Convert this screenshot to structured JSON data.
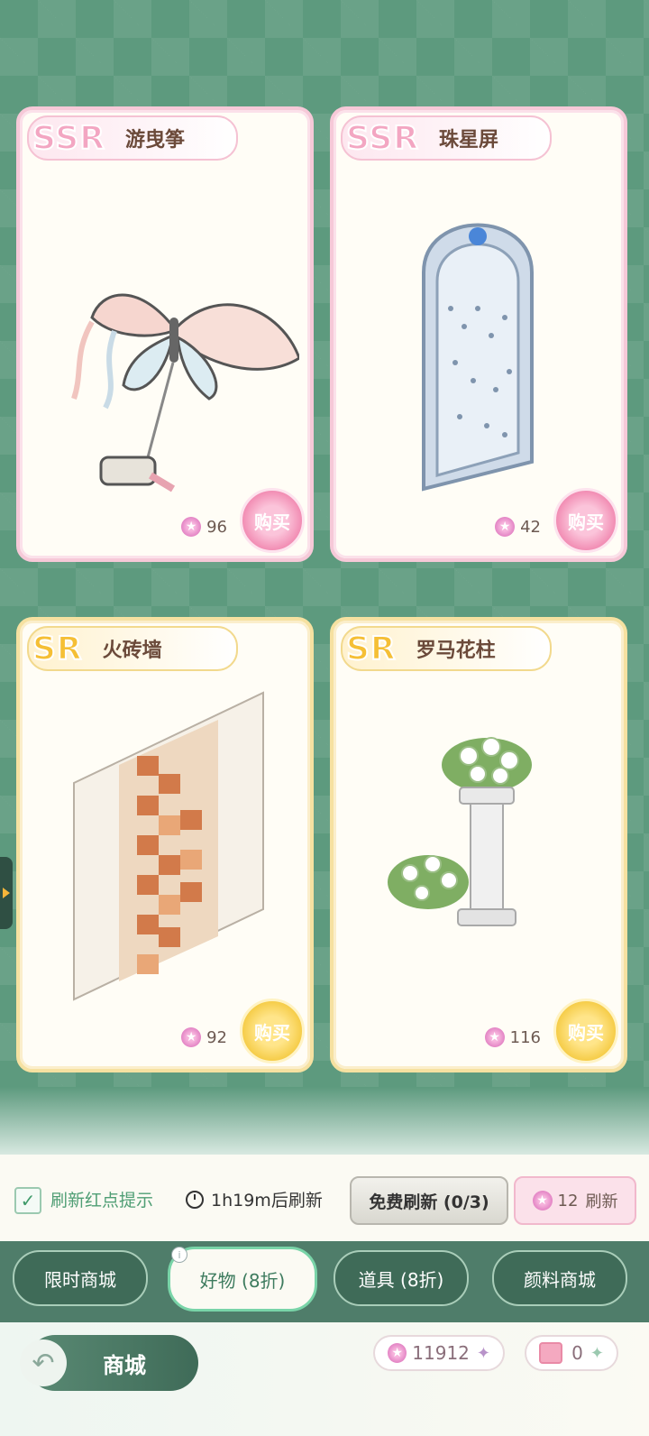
{
  "cards": [
    {
      "rarity": "SSR",
      "name": "游曳筝",
      "price": "96",
      "buy_label": "购买"
    },
    {
      "rarity": "SSR",
      "name": "珠星屏",
      "price": "42",
      "buy_label": "购买"
    },
    {
      "rarity": "SR",
      "name": "火砖墙",
      "price": "92",
      "buy_label": "购买"
    },
    {
      "rarity": "SR",
      "name": "罗马花柱",
      "price": "116",
      "buy_label": "购买"
    }
  ],
  "refresh": {
    "checkbox_checked": true,
    "hint_label": "刷新红点提示",
    "timer_label": "1h19m后刷新",
    "free_button": "免费刷新 (0/3)",
    "paid_cost": "12",
    "paid_label": "刷新"
  },
  "tabs": [
    {
      "label": "限时商城",
      "active": false
    },
    {
      "label": "好物 (8折)",
      "active": true
    },
    {
      "label": "道具 (8折)",
      "active": false
    },
    {
      "label": "颜料商城",
      "active": false
    }
  ],
  "tab_info_icon": "i",
  "bottom": {
    "back_label": "商城",
    "currency_gems": "11912",
    "currency_tickets": "0"
  },
  "colors": {
    "ssr_accent": "#f3a6c2",
    "sr_accent": "#f5bf35",
    "bg_green": "#5d9a7e"
  }
}
